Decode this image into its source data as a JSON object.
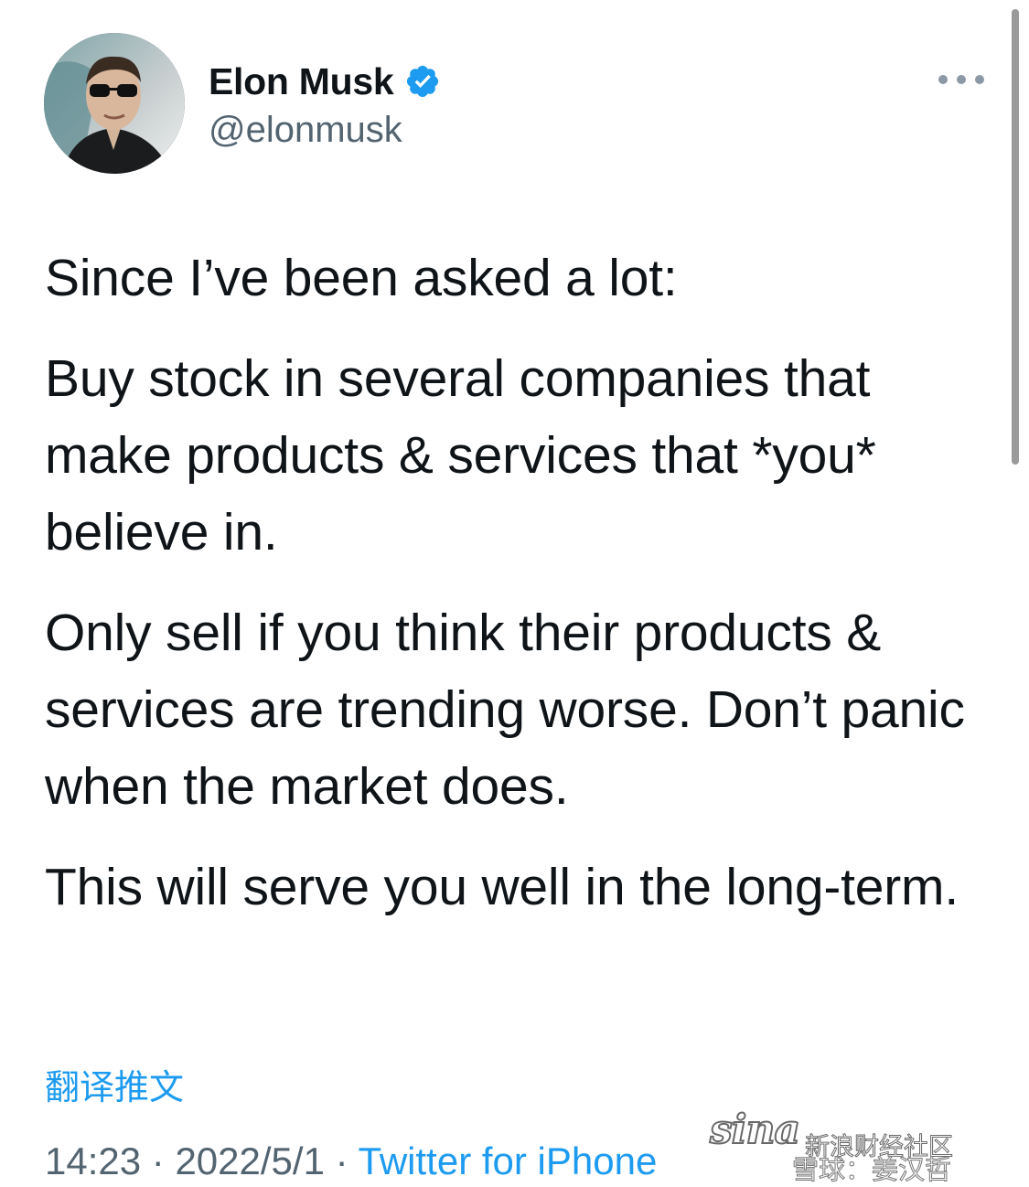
{
  "user": {
    "display_name": "Elon Musk",
    "handle": "@elonmusk",
    "verified": true,
    "avatar_icon": "profile-photo"
  },
  "tweet": {
    "paragraphs": [
      "Since I’ve been asked a lot:",
      "Buy stock in several companies that make products & services that *you* believe in.",
      "Only sell if you think their products & services are trending worse. Don’t panic when the market does.",
      "This will serve you well in the long-term."
    ],
    "translate_label": "翻译推文",
    "time": "14:23",
    "separator": " · ",
    "date": "2022/5/1",
    "source": "Twitter for iPhone"
  },
  "icons": {
    "more": "more-horizontal-icon",
    "verified": "verified-badge-icon"
  },
  "watermark": {
    "logo": "sina",
    "line1": "新浪财经社区",
    "line2": "雪球：姜汉哲"
  },
  "colors": {
    "text_primary": "#0f1419",
    "text_secondary": "#536471",
    "accent": "#1d9bf0"
  }
}
